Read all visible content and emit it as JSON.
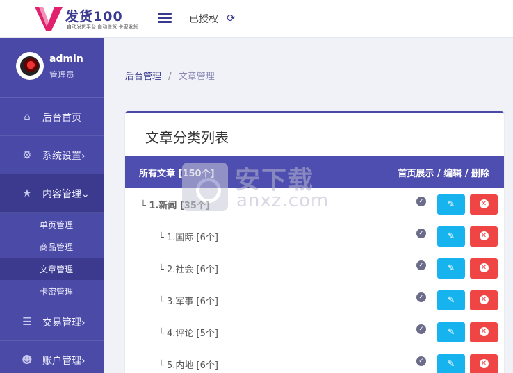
{
  "app": {
    "logo_text": "发货100",
    "logo_tagline": "自动发货平台 自动售货 卡密发货",
    "auth_status": "已授权"
  },
  "user": {
    "name": "admin",
    "role": "管理员"
  },
  "sidebar": {
    "items": [
      {
        "label": "后台首页",
        "icon": "home-icon"
      },
      {
        "label": "系统设置",
        "icon": "gear-icon"
      },
      {
        "label": "内容管理",
        "icon": "star-icon"
      }
    ],
    "submenu": [
      {
        "label": "单页管理"
      },
      {
        "label": "商品管理"
      },
      {
        "label": "文章管理"
      },
      {
        "label": "卡密管理"
      }
    ],
    "items_after": [
      {
        "label": "交易管理",
        "icon": "list-icon"
      },
      {
        "label": "账户管理",
        "icon": "users-icon"
      }
    ]
  },
  "breadcrumb": {
    "parent": "后台管理",
    "separator": "/",
    "current": "文章管理"
  },
  "card": {
    "title": "文章分类列表",
    "header_left": "所有文章 [150个]",
    "header_right": "首页展示 / 编辑 / 删除",
    "rows": [
      {
        "label": "└ 1.新闻 [35个]",
        "level": 0
      },
      {
        "label": "└ 1.国际 [6个]",
        "level": 1
      },
      {
        "label": "└ 2.社会 [6个]",
        "level": 1
      },
      {
        "label": "└ 3.军事 [6个]",
        "level": 1
      },
      {
        "label": "└ 4.评论 [5个]",
        "level": 1
      },
      {
        "label": "└ 5.内地 [6个]",
        "level": 1
      }
    ]
  },
  "watermark": {
    "cn": "安下载",
    "en": "anxz.com"
  },
  "colors": {
    "sidebar": "#4a49a8",
    "accent": "#3a3a8c",
    "edit": "#16b3ee",
    "delete": "#f04545"
  }
}
